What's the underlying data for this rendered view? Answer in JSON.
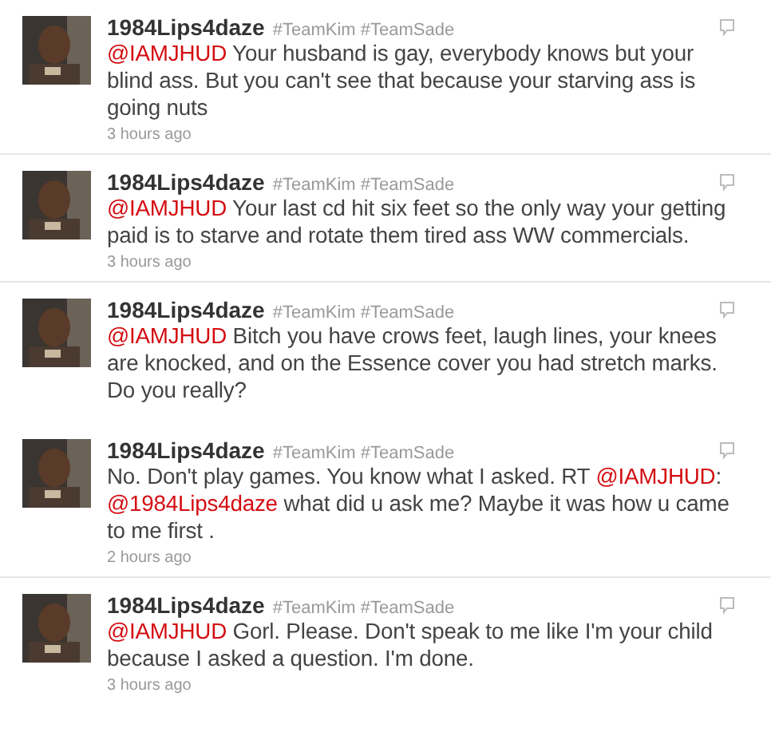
{
  "tweets": [
    {
      "user": "1984Lips4daze",
      "tags": "#TeamKim #TeamSade",
      "body": [
        {
          "kind": "mention",
          "text": "@IAMJHUD"
        },
        {
          "kind": "text",
          "text": " Your husband is gay, everybody knows but your blind ass. But you can't see that because your starving ass is going nuts"
        }
      ],
      "time": "3 hours ago"
    },
    {
      "user": "1984Lips4daze",
      "tags": "#TeamKim #TeamSade",
      "body": [
        {
          "kind": "mention",
          "text": "@IAMJHUD"
        },
        {
          "kind": "text",
          "text": " Your last cd hit six feet so the only way your getting paid is to starve and rotate them tired ass WW commercials."
        }
      ],
      "time": "3 hours ago"
    },
    {
      "user": "1984Lips4daze",
      "tags": "#TeamKim #TeamSade",
      "body": [
        {
          "kind": "mention",
          "text": "@IAMJHUD"
        },
        {
          "kind": "text",
          "text": " Bitch you have crows feet, laugh lines, your knees are knocked, and on the Essence cover you had stretch marks. Do you really?"
        }
      ]
    },
    {
      "user": "1984Lips4daze",
      "tags": "#TeamKim #TeamSade",
      "body": [
        {
          "kind": "text",
          "text": "No. Don't play games. You know what I asked. RT "
        },
        {
          "kind": "mention",
          "text": "@IAMJHUD"
        },
        {
          "kind": "text",
          "text": ": "
        },
        {
          "kind": "mention",
          "text": "@1984Lips4daze"
        },
        {
          "kind": "text",
          "text": " what did u ask me? Maybe it was how u came to me first ."
        }
      ],
      "time": "2 hours ago"
    },
    {
      "user": "1984Lips4daze",
      "tags": "#TeamKim #TeamSade",
      "body": [
        {
          "kind": "mention",
          "text": "@IAMJHUD"
        },
        {
          "kind": "text",
          "text": " Gorl. Please. Don't speak to me like I'm your child because I asked a question. I'm done."
        }
      ],
      "time": "3 hours ago"
    }
  ]
}
